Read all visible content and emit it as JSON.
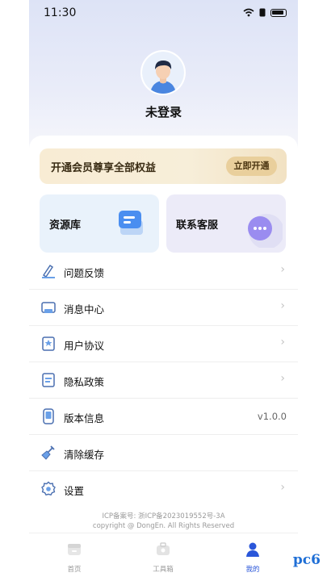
{
  "status": {
    "time": "11:30"
  },
  "profile": {
    "login_text": "未登录"
  },
  "vip": {
    "text": "开通会员尊享全部权益",
    "button": "立即开通"
  },
  "tiles": [
    {
      "label": "资源库"
    },
    {
      "label": "联系客服"
    }
  ],
  "menu": [
    {
      "label": "问题反馈",
      "icon": "feedback-icon",
      "chevron": "›"
    },
    {
      "label": "消息中心",
      "icon": "message-icon",
      "chevron": "›"
    },
    {
      "label": "用户协议",
      "icon": "agreement-icon",
      "chevron": "›"
    },
    {
      "label": "隐私政策",
      "icon": "privacy-icon",
      "chevron": "›"
    },
    {
      "label": "版本信息",
      "icon": "version-icon",
      "value": "v1.0.0"
    },
    {
      "label": "清除缓存",
      "icon": "broom-icon"
    },
    {
      "label": "设置",
      "icon": "settings-icon",
      "chevron": "›"
    }
  ],
  "footer": {
    "icp": "ICP备案号: 浙ICP备2023019552号-3A",
    "copyright": "copyright @ DongEn. All Rights Reserved"
  },
  "tabbar": [
    {
      "label": "首页",
      "icon": "home-icon"
    },
    {
      "label": "工具箱",
      "icon": "toolbox-icon"
    },
    {
      "label": "我的",
      "icon": "profile-icon",
      "active": true
    }
  ],
  "watermark": "pc6",
  "colors": {
    "accent": "#2a56d9",
    "vip_bg": "#f8ecd4",
    "vip_button": "#e9cf9c"
  }
}
